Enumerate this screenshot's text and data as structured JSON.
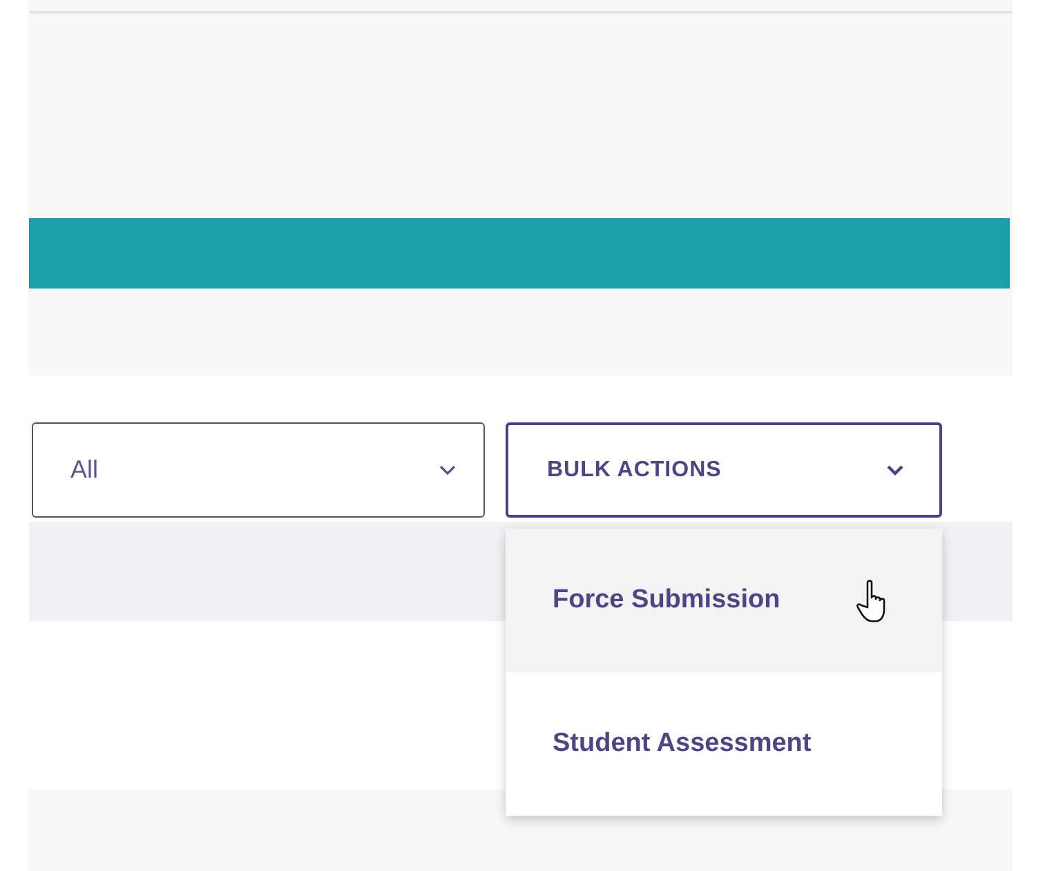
{
  "filter_select": {
    "value": "All"
  },
  "bulk_actions": {
    "label": "BULK ACTIONS",
    "expanded": true,
    "items": [
      {
        "label": "Force Submission",
        "highlighted": true
      },
      {
        "label": "Student Assessment",
        "highlighted": false
      }
    ]
  }
}
